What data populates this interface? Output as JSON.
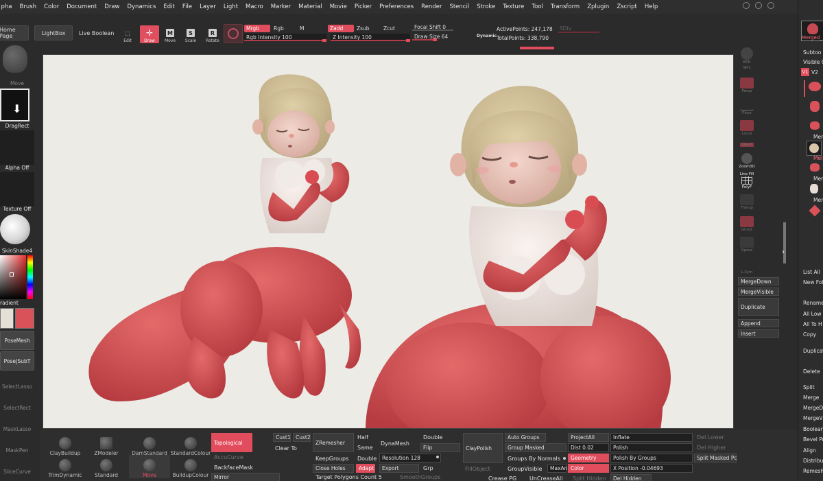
{
  "menu": [
    "pha",
    "Brush",
    "Color",
    "Document",
    "Draw",
    "Dynamics",
    "Edit",
    "File",
    "Layer",
    "Light",
    "Macro",
    "Marker",
    "Material",
    "Movie",
    "Picker",
    "Preferences",
    "Render",
    "Stencil",
    "Stroke",
    "Texture",
    "Tool",
    "Transform",
    "Zplugin",
    "Zscript",
    "Help"
  ],
  "top": {
    "home": "Home Page",
    "lightbox": "LightBox",
    "liveboolean": "Live Boolean",
    "edit": "Edit",
    "draw": "Draw",
    "move": "Move",
    "scale": "Scale",
    "rotate": "Rotate",
    "mrgb": "Mrgb",
    "rgb": "Rgb",
    "m": "M",
    "rgbint": "Rgb Intensity 100",
    "zadd": "Zadd",
    "zsub": "Zsub",
    "zcut": "Zcut",
    "zint": "Z Intensity 100",
    "focal": "Focal Shift 0",
    "drawsize": "Draw Size 64",
    "dynamic": "Dynamic",
    "active": "ActivePoints: 247,178",
    "total": "TotalPoints: 338,790",
    "sdiv": "SDiv"
  },
  "left": {
    "move": "Move",
    "dragrect": "DragRect",
    "alphaoff": "Alpha Off",
    "textureoff": "Texture Off",
    "skinshade": "SkinShade4",
    "gradient": "radient",
    "posemesh": "PoseMesh",
    "posesubt": "Pose|SubT",
    "selectlasso": "SelectLasso",
    "selectrect": "SelectRect",
    "masklasso": "MaskLasso",
    "maskpen": "MaskPen",
    "slicecurve": "SliceCurve"
  },
  "right": {
    "bpr": "BPR",
    "spix": "SPix",
    "persp": "Persp",
    "floor": "Floor",
    "local": "Local",
    "qxyz": "Qxyz",
    "zoom3d": "Zoom3D",
    "linefill": "Line Fill",
    "polyf": "PolyF",
    "transp": "Transp",
    "ghost": "Ghost",
    "xpose": "Xpose",
    "lsym": "L.Sym",
    "mergedown": "MergeDown",
    "mergevisible": "MergeVisible",
    "duplicate": "Duplicate",
    "append": "Append",
    "insert": "Insert"
  },
  "subtool": {
    "top": "Merged_",
    "subtoo": "Subtoo",
    "visible": "Visible C",
    "v1": "V1",
    "v2": "V2",
    "items": [
      "Mer",
      "Mer",
      "Mer",
      "Mer"
    ],
    "listall": "List All",
    "newfol": "New Fol",
    "rename": "Rename",
    "alllow": "All Low",
    "alltoh": "All To H",
    "copy": "Copy",
    "duplic": "Duplicat",
    "delete": "Delete",
    "split": "Split",
    "merge": "Merge",
    "merged": "MergeD",
    "mergev": "MergeV",
    "boolea": "Boolean",
    "bevelp": "Bevel Pr",
    "align": "Align",
    "distrib": "Distribu",
    "remesh": "Remesh"
  },
  "bottom": {
    "brushes": [
      "ClayBuildup",
      "ZModeler",
      "DamStandard",
      "StandardColour",
      "TrimDynamic",
      "Standard",
      "Move",
      "BuildupColour"
    ],
    "topological": "Topological",
    "accucurve": "AccuCurve",
    "backfacemask": "BackfaceMask",
    "mirror": "Mirror",
    "cust1": "Cust1",
    "cust2": "Cust2",
    "clearto": "Clear To",
    "zremesher": "ZRemesher",
    "half": "Half",
    "same": "Same",
    "double": "Double",
    "keepgroups": "KeepGroups",
    "closeholes": "Close Holes",
    "adapt": "Adapt",
    "targetpoly": "Target Polygons Count 5",
    "dynamesh": "DynaMesh",
    "double2": "Double",
    "flip": "Flip",
    "resolution": "Resolution 128",
    "export": "Export",
    "grp": "Grp",
    "smoothgroups": "SmoothGroups",
    "claypolish": "ClayPolish",
    "fillobject": "FillObject",
    "autogroups": "Auto Groups",
    "groupmasked": "Group Masked",
    "groupsbynormals": "Groups By Normals",
    "groupvisible": "GroupVisible",
    "maxang": "MaxAn",
    "createpg": "Crease PG",
    "uncreaseall": "UnCreaseAll",
    "projectall": "ProjectAll",
    "dist": "Dist 0.02",
    "geometry": "Geometry",
    "color": "Color",
    "splithidden": "Split Hidden",
    "inflate": "Inflate",
    "polish": "Polish",
    "polishbygroups": "Polish By Groups",
    "xposition": "X Position -0.04693",
    "delhidden": "Del Hidden",
    "dellower": "Del Lower",
    "delhigher": "Del Higher",
    "splitmasked": "Split Masked Pc"
  }
}
